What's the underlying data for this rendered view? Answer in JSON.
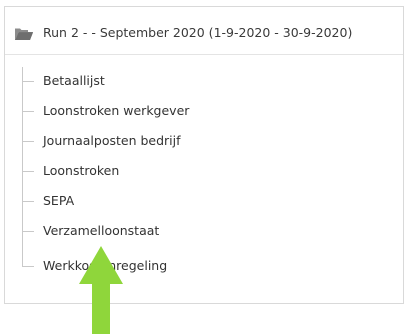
{
  "header": {
    "title": "Run 2 - - September 2020 (1-9-2020 - 30-9-2020)",
    "icon": "folder-icon"
  },
  "tree": {
    "items": [
      {
        "label": "Betaallijst"
      },
      {
        "label": "Loonstroken werkgever"
      },
      {
        "label": "Journaalposten bedrijf"
      },
      {
        "label": "Loonstroken"
      },
      {
        "label": "SEPA"
      },
      {
        "label": "Verzamelloonstaat"
      },
      {
        "label": "Werkkostenregeling"
      }
    ]
  },
  "colors": {
    "arrow": "#8fd63b",
    "tree_line": "#c9c9c9",
    "folder": "#7a7a7a"
  }
}
